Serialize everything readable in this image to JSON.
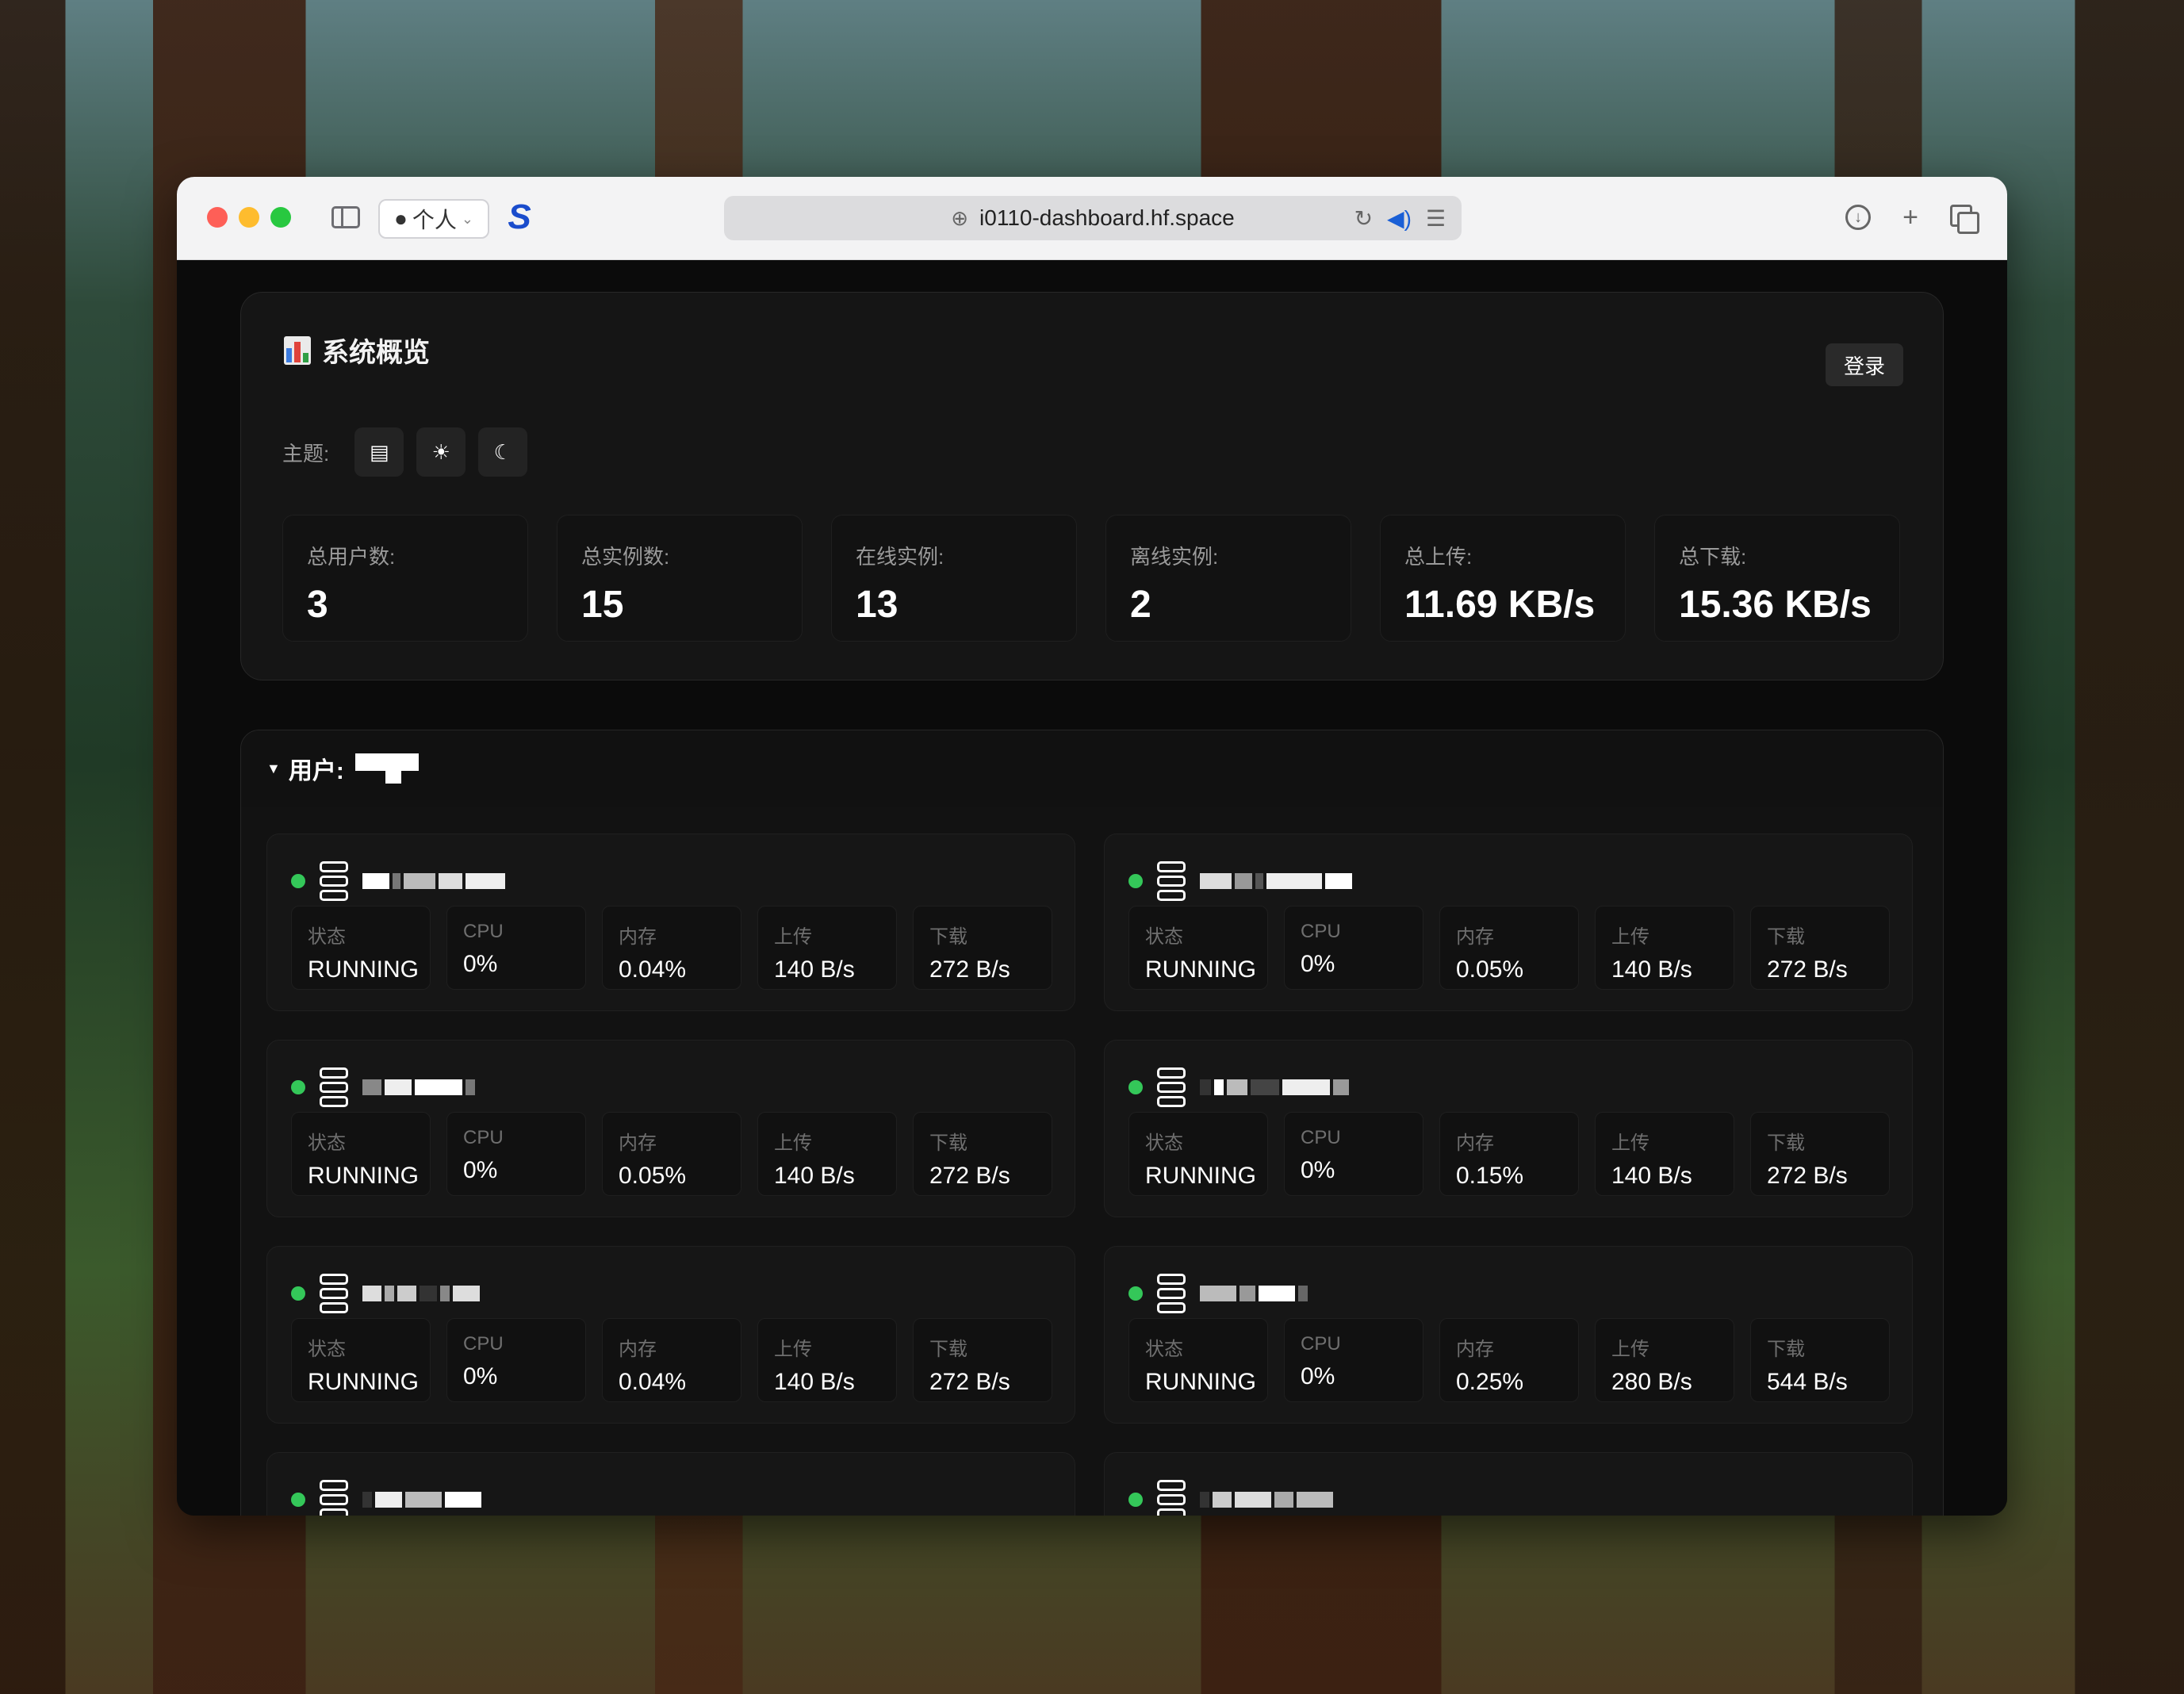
{
  "browser": {
    "profile_label": "个人",
    "url": "i0110-dashboard.hf.space"
  },
  "overview": {
    "title": "系统概览",
    "login_label": "登录",
    "theme_label": "主题:",
    "stats": [
      {
        "label": "总用户数:",
        "value": "3"
      },
      {
        "label": "总实例数:",
        "value": "15"
      },
      {
        "label": "在线实例:",
        "value": "13"
      },
      {
        "label": "离线实例:",
        "value": "2"
      },
      {
        "label": "总上传:",
        "value": "11.69 KB/s"
      },
      {
        "label": "总下载:",
        "value": "15.36 KB/s"
      }
    ]
  },
  "user_section": {
    "label": "用户:",
    "metric_labels": {
      "status": "状态",
      "cpu": "CPU",
      "memory": "内存",
      "upload": "上传",
      "download": "下载"
    },
    "instances": [
      {
        "status": "RUNNING",
        "cpu": "0%",
        "memory": "0.04%",
        "upload": "140 B/s",
        "download": "272 B/s"
      },
      {
        "status": "RUNNING",
        "cpu": "0%",
        "memory": "0.05%",
        "upload": "140 B/s",
        "download": "272 B/s"
      },
      {
        "status": "RUNNING",
        "cpu": "0%",
        "memory": "0.05%",
        "upload": "140 B/s",
        "download": "272 B/s"
      },
      {
        "status": "RUNNING",
        "cpu": "0%",
        "memory": "0.15%",
        "upload": "140 B/s",
        "download": "272 B/s"
      },
      {
        "status": "RUNNING",
        "cpu": "0%",
        "memory": "0.04%",
        "upload": "140 B/s",
        "download": "272 B/s"
      },
      {
        "status": "RUNNING",
        "cpu": "0%",
        "memory": "0.25%",
        "upload": "280 B/s",
        "download": "544 B/s"
      }
    ]
  },
  "colors": {
    "online_dot": "#34c759",
    "panel_bg": "#151515",
    "page_bg": "#0b0b0b"
  }
}
